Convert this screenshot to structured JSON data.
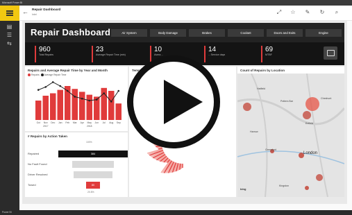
{
  "window": {
    "title": "Microsoft Power BI"
  },
  "app": {
    "report_title": "Repair Dashboard",
    "report_subtitle": "Intel"
  },
  "dashboard": {
    "title": "Repair Dashboard",
    "tabs": [
      "Air System",
      "Body Damage",
      "Brakes",
      "Coolant",
      "Doors and Exits",
      "Engine"
    ],
    "kpis": [
      {
        "value": "960",
        "label": "Total Repairs"
      },
      {
        "value": "23",
        "label": "Average Repair Time (min)"
      },
      {
        "value": "10",
        "label": "Avera…"
      },
      {
        "value": "14",
        "label": "…Service days"
      },
      {
        "value": "69",
        "label": "MTBF"
      }
    ]
  },
  "panels": {
    "repairs_chart": {
      "title": "Repairs and Average Repair Time by Year and Month",
      "legend": [
        "Repairs",
        "Average Repair Time"
      ],
      "year_labels": [
        "2017",
        "2018"
      ]
    },
    "funnel": {
      "title": "# Repairs by Action Taken",
      "top_pct": "100%",
      "bottom_pct": "20.8%",
      "rows": [
        {
          "label": "Repaired",
          "value": "384"
        },
        {
          "label": "No Fault Found",
          "value": ""
        },
        {
          "label": "Driver Resolved",
          "value": ""
        },
        {
          "label": "Towed",
          "value": "80"
        }
      ]
    },
    "middle": {
      "title": "Tempor…"
    },
    "map": {
      "title": "Count of Repairs by Location",
      "city_label": "London",
      "places": [
        "Hatfield",
        "Potters Bar",
        "Cheshunt",
        "Enfield",
        "Harrow",
        "Greenford",
        "Kingston"
      ],
      "attribution": "bing"
    }
  },
  "chart_data": {
    "type": "bar",
    "title": "Repairs and Average Repair Time by Year and Month",
    "categories": [
      "Oct",
      "Nov",
      "Dec",
      "Jan",
      "Feb",
      "Mar",
      "Apr",
      "May",
      "Jun",
      "Jul",
      "Aug",
      "Sep"
    ],
    "series": [
      {
        "name": "Repairs",
        "values": [
          40,
          50,
          55,
          62,
          70,
          64,
          58,
          52,
          48,
          66,
          60,
          34
        ]
      },
      {
        "name": "Average Repair Time",
        "values": [
          62,
          68,
          78,
          70,
          60,
          48,
          44,
          40,
          42,
          55,
          38,
          60
        ]
      }
    ],
    "ylim": [
      0,
      80
    ],
    "legend_position": "top-left"
  },
  "colors": {
    "accent": "#e03b3b",
    "header_bg": "#232323",
    "kpi_bg": "#141414",
    "rail_accent": "#f2c811"
  }
}
